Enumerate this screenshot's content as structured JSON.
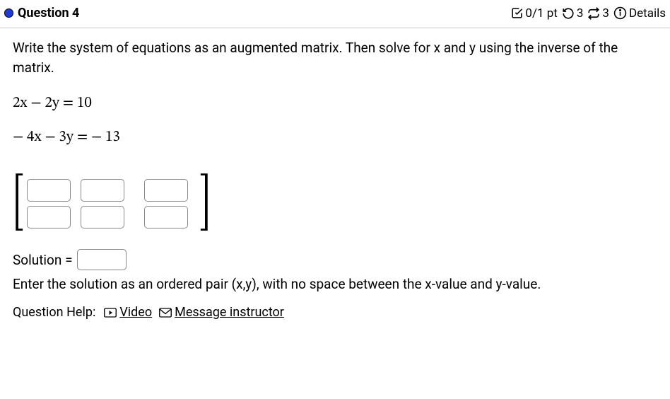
{
  "header": {
    "title": "Question 4",
    "score": "0/1 pt",
    "retry_count": "3",
    "reattempt_count": "3",
    "details_label": "Details"
  },
  "instructions": "Write the system of equations as an augmented matrix. Then solve for x and y using the inverse of the matrix.",
  "equations": {
    "eq1": "2x − 2y = 10",
    "eq2": "− 4x − 3y =  − 13"
  },
  "solution": {
    "label": "Solution =",
    "hint": "Enter the solution as an ordered pair (x,y), with no space between the x-value and y-value."
  },
  "help": {
    "label": "Question Help:",
    "video": "Video",
    "message": "Message instructor"
  }
}
